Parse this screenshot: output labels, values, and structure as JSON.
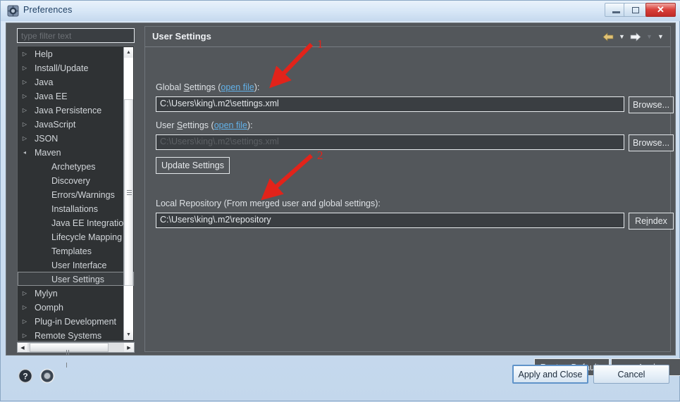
{
  "window": {
    "title": "Preferences",
    "icon": "preferences-icon",
    "controls": {
      "minimize": "minimize-icon",
      "maximize": "maximize-icon",
      "close": "✕"
    }
  },
  "sidebar": {
    "filter": {
      "placeholder": "type filter text",
      "value": ""
    },
    "items": [
      {
        "label": "Help",
        "level": "top",
        "expander": "collapsed"
      },
      {
        "label": "Install/Update",
        "level": "top",
        "expander": "collapsed"
      },
      {
        "label": "Java",
        "level": "top",
        "expander": "collapsed"
      },
      {
        "label": "Java EE",
        "level": "top",
        "expander": "collapsed"
      },
      {
        "label": "Java Persistence",
        "level": "top",
        "expander": "collapsed"
      },
      {
        "label": "JavaScript",
        "level": "top",
        "expander": "collapsed"
      },
      {
        "label": "JSON",
        "level": "top",
        "expander": "collapsed"
      },
      {
        "label": "Maven",
        "level": "top",
        "expander": "expanded"
      },
      {
        "label": "Archetypes",
        "level": "child",
        "expander": "none"
      },
      {
        "label": "Discovery",
        "level": "child",
        "expander": "none"
      },
      {
        "label": "Errors/Warnings",
        "level": "child",
        "expander": "none"
      },
      {
        "label": "Installations",
        "level": "child",
        "expander": "none"
      },
      {
        "label": "Java EE Integration",
        "level": "child",
        "expander": "none"
      },
      {
        "label": "Lifecycle Mapping",
        "level": "child",
        "expander": "none"
      },
      {
        "label": "Templates",
        "level": "child",
        "expander": "none"
      },
      {
        "label": "User Interface",
        "level": "child",
        "expander": "none"
      },
      {
        "label": "User Settings",
        "level": "child",
        "expander": "none",
        "selected": true
      },
      {
        "label": "Mylyn",
        "level": "top",
        "expander": "collapsed"
      },
      {
        "label": "Oomph",
        "level": "top",
        "expander": "collapsed"
      },
      {
        "label": "Plug-in Development",
        "level": "top",
        "expander": "collapsed"
      },
      {
        "label": "Remote Systems",
        "level": "top",
        "expander": "collapsed"
      }
    ],
    "scroll": {
      "vertical_up": "▲",
      "vertical_down": "▼",
      "horizontal_left": "◀",
      "horizontal_right": "▶"
    }
  },
  "panel": {
    "title": "User Settings",
    "nav": {
      "back": "➤",
      "back_menu": "▼",
      "forward": "➤",
      "forward_menu": "▼",
      "view_menu": "▼"
    },
    "global_settings": {
      "label_prefix": "Global ",
      "label_mnemonic": "S",
      "label_rest": "ettings (",
      "link": "open file",
      "label_suffix": "):",
      "value": "C:\\Users\\king\\.m2\\settings.xml",
      "browse_label": "Browse..."
    },
    "user_settings": {
      "label_prefix": "User ",
      "label_mnemonic": "S",
      "label_rest": "ettings (",
      "link": "open file",
      "label_suffix": "):",
      "placeholder": "C:\\Users\\king\\.m2\\settings.xml",
      "value": "",
      "browse_label": "Browse..."
    },
    "update_settings_label": "Update Settings",
    "local_repository": {
      "label": "Local Repository (From merged user and global settings):",
      "value": "C:\\Users\\king\\.m2\\repository",
      "reindex_prefix": "Re",
      "reindex_mnemonic": "i",
      "reindex_rest": "ndex"
    },
    "restore_defaults": {
      "prefix": "Restore ",
      "mnemonic": "D",
      "rest": "efaults"
    },
    "apply": {
      "mnemonic": "A",
      "rest": "pply"
    }
  },
  "footer": {
    "help_icon": "question-mark-icon",
    "config_icon": "config-circle-icon",
    "apply_and_close": "Apply and Close",
    "cancel": "Cancel"
  },
  "annotations": [
    {
      "number": "1",
      "target": "global-settings-field"
    },
    {
      "number": "2",
      "target": "local-repository-field"
    }
  ],
  "colors": {
    "dialog_bg": "#53575b",
    "tree_bg": "#2f3234",
    "field_bg": "#3a3e42",
    "link": "#62b1e8",
    "annotation_red": "#e2231a",
    "close_red": "#d9403a",
    "nav_back": "#e0c276"
  }
}
